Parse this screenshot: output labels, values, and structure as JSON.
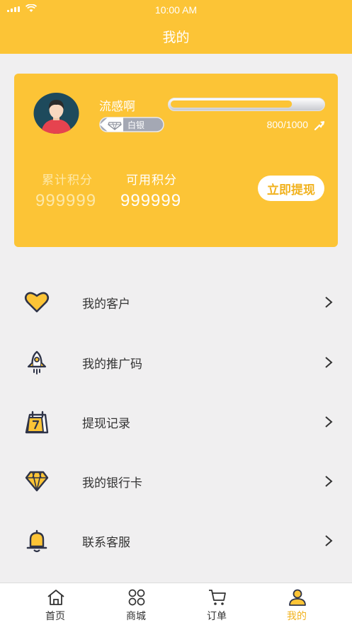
{
  "status_bar": {
    "time": "10:00 AM"
  },
  "nav": {
    "title": "我的"
  },
  "profile": {
    "username": "流感啊",
    "level_name": "白银",
    "progress_text": "800/1000",
    "progress_fraction": 0.8,
    "accumulated_label": "累计积分",
    "accumulated_value": "999999",
    "available_label": "可用积分",
    "available_value": "999999",
    "withdraw_label": "立即提现"
  },
  "menu": [
    {
      "label": "我的客户",
      "icon": "heart-icon"
    },
    {
      "label": "我的推广码",
      "icon": "rocket-icon"
    },
    {
      "label": "提现记录",
      "icon": "calendar-icon"
    },
    {
      "label": "我的银行卡",
      "icon": "diamond-icon"
    },
    {
      "label": "联系客服",
      "icon": "bell-icon"
    }
  ],
  "tabs": [
    {
      "label": "首页",
      "icon": "home-icon"
    },
    {
      "label": "商城",
      "icon": "grid-icon"
    },
    {
      "label": "订单",
      "icon": "cart-icon"
    },
    {
      "label": "我的",
      "icon": "user-icon",
      "active": true
    }
  ],
  "colors": {
    "accent": "#fcc436",
    "icon_dark": "#2f3448",
    "active_tab": "#f1b21e"
  }
}
